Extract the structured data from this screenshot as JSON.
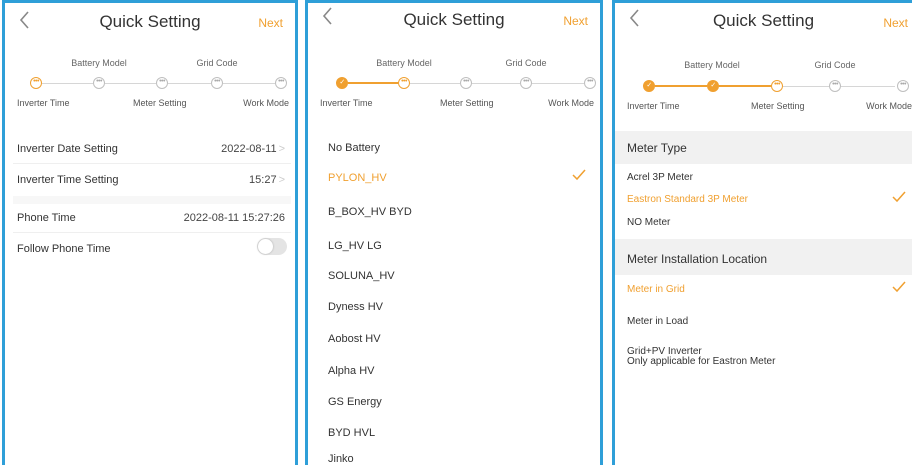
{
  "header": {
    "title": "Quick Setting",
    "next_label": "Next"
  },
  "steps": {
    "top": [
      "Battery Model",
      "Grid Code"
    ],
    "bottom": [
      "Inverter Time",
      "Meter Setting",
      "Work Mode"
    ]
  },
  "time_screen": {
    "rows": [
      {
        "label": "Inverter Date Setting",
        "value": "2022-08-11",
        "chevron": ">"
      },
      {
        "label": "Inverter Time Setting",
        "value": "15:27",
        "chevron": ">"
      },
      {
        "label": "Phone Time",
        "value": "2022-08-11 15:27:26"
      },
      {
        "label": "Follow Phone Time",
        "toggle": false
      }
    ]
  },
  "battery_screen": {
    "items": [
      "No Battery",
      "PYLON_HV",
      "B_BOX_HV BYD",
      "LG_HV LG",
      "SOLUNA_HV",
      "Dyness HV",
      "Aobost HV",
      "Alpha HV",
      "GS Energy",
      "BYD HVL",
      "Jinko"
    ],
    "selected": "PYLON_HV"
  },
  "meter_screen": {
    "meter_type": {
      "heading": "Meter Type",
      "options": [
        "Acrel 3P Meter",
        "Eastron Standard 3P Meter",
        "NO Meter"
      ],
      "selected": "Eastron Standard 3P Meter"
    },
    "location": {
      "heading": "Meter Installation Location",
      "options": [
        "Meter in Grid",
        "Meter in Load"
      ],
      "selected": "Meter in Grid",
      "extra_option": {
        "line1": "Grid+PV Inverter",
        "line2": "Only applicable for Eastron Meter"
      }
    }
  },
  "colors": {
    "accent": "#f0a030",
    "frame": "#2e9fd8",
    "section_bg": "#f1f1f1"
  }
}
